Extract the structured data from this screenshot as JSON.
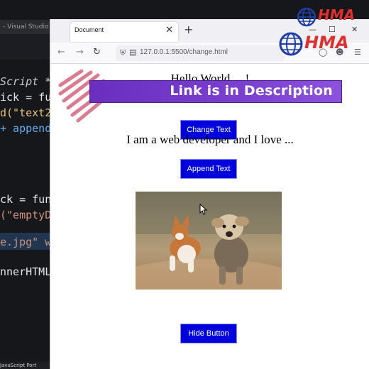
{
  "vscode": {
    "title": "- Visual Studio Code",
    "status": "JavaScript  Port",
    "code_lines": [
      {
        "text": "Script */",
        "cls": "c-italic"
      },
      {
        "text": "ick = func",
        "cls": "c-white"
      },
      {
        "text": "d(\"text2\"",
        "cls": "c-yellow"
      },
      {
        "text": " + append",
        "cls": "c-blue"
      },
      {
        "text": "ck = func",
        "cls": "c-white"
      },
      {
        "text": "(\"emptyDi",
        "cls": "c-orange"
      },
      {
        "text": "e.jpg\" wi",
        "cls": "c-orange"
      },
      {
        "text": "nnerHTML",
        "cls": "c-white"
      }
    ]
  },
  "browser": {
    "tab_title": "Document",
    "tab_close": "✕",
    "new_tab": "+",
    "url": "127.0.0.1:5500/change.html",
    "window_controls": {
      "minimize": "—",
      "maximize": "☐",
      "close": "✕"
    }
  },
  "page": {
    "heading": "Hello World ... !",
    "paragraph": "I am a web developer and I love ...",
    "buttons": {
      "change": "Change Text",
      "append": "Append Text",
      "hide": "Hide Button"
    },
    "image_alt": "corgi and terrier running on a dirt path"
  },
  "overlay": {
    "banner": "Link is in Description",
    "logo": "HMA",
    "banner_color": "#7b3fcf",
    "logo_color": "#e0302d"
  },
  "icons": {
    "back": "back-arrow-icon",
    "forward": "forward-arrow-icon",
    "reload": "reload-icon",
    "shield": "shield-icon",
    "page": "page-icon"
  }
}
